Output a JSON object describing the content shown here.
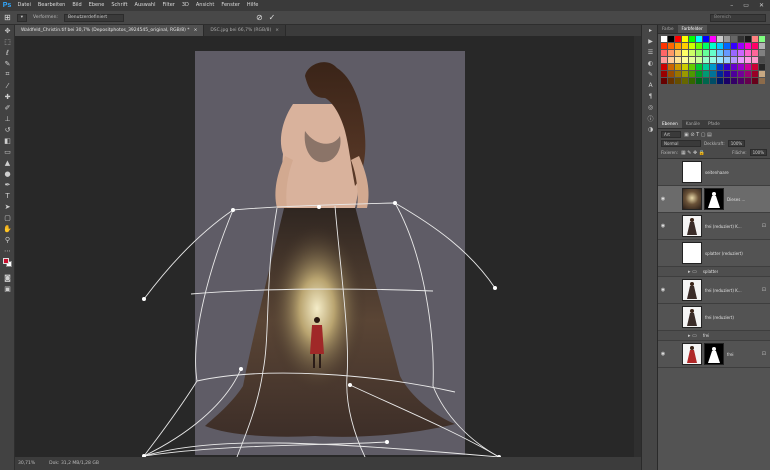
{
  "app": {
    "logo": "Ps"
  },
  "menu": [
    "Datei",
    "Bearbeiten",
    "Bild",
    "Ebene",
    "Schrift",
    "Auswahl",
    "Filter",
    "3D",
    "Ansicht",
    "Fenster",
    "Hilfe"
  ],
  "window_controls": [
    "–",
    "▭",
    "✕"
  ],
  "options": {
    "interpolation_label": "Verformen:",
    "interpolation_value": "Benutzerdefiniert",
    "cancel": "⊘",
    "commit": "✓"
  },
  "search": {
    "placeholder": "Bereich"
  },
  "tabs": [
    {
      "label": "Waldfeld_Christin.tif bei 30,7% (Depositphotos_3924545_original, RGB/8) *",
      "close": "×"
    },
    {
      "label": "DSC.jpg bei 66,7% (RGB/8)",
      "close": "×"
    }
  ],
  "status": {
    "zoom": "30,71%",
    "doc": "Dok: 31,2 MB/1,28 GB"
  },
  "panels": {
    "swatch_tabs": [
      "Farbe",
      "Farbfelder"
    ],
    "layer_tabs": [
      "Ebenen",
      "Kanäle",
      "Pfade"
    ],
    "kind_label": "Art",
    "blend_mode": "Normal",
    "opacity_label": "Deckkraft:",
    "opacity_value": "100%",
    "fill_label": "Fläche:",
    "fill_value": "100%",
    "lock_label": "Fixieren:"
  },
  "swatch_colors": [
    "#ffffff",
    "#000000",
    "#ff0000",
    "#ffff00",
    "#00ff00",
    "#00ffff",
    "#0000ff",
    "#ff00ff",
    "#cccccc",
    "#999999",
    "#666666",
    "#333333",
    "#1a1a1a",
    "#ff8080",
    "#80ff80",
    "#ff3300",
    "#ff6600",
    "#ff9900",
    "#ffcc00",
    "#ccff00",
    "#66ff00",
    "#00ff66",
    "#00ffcc",
    "#00ccff",
    "#0066ff",
    "#3300ff",
    "#9900ff",
    "#ff00cc",
    "#ff0066",
    "#b3b3b3",
    "#ff6666",
    "#ff9966",
    "#ffcc66",
    "#ffff66",
    "#ccff66",
    "#99ff66",
    "#66ff99",
    "#66ffcc",
    "#66ccff",
    "#6699ff",
    "#9966ff",
    "#cc66ff",
    "#ff66cc",
    "#ff6699",
    "#808080",
    "#ff9999",
    "#ffcc99",
    "#ffe699",
    "#ffff99",
    "#e6ff99",
    "#ccff99",
    "#99ffcc",
    "#99ffe6",
    "#99e6ff",
    "#99ccff",
    "#b399ff",
    "#e699ff",
    "#ff99e6",
    "#ff99cc",
    "#4d4d4d",
    "#cc0000",
    "#cc6600",
    "#cc9900",
    "#cccc00",
    "#66cc00",
    "#00cc33",
    "#00cc99",
    "#0099cc",
    "#0033cc",
    "#3300cc",
    "#6600cc",
    "#9900cc",
    "#cc0099",
    "#cc0033",
    "#262626",
    "#990000",
    "#994c00",
    "#997300",
    "#999900",
    "#4d9900",
    "#009926",
    "#009973",
    "#007399",
    "#002699",
    "#260099",
    "#4d0099",
    "#730099",
    "#990073",
    "#990026",
    "#c8a882",
    "#660000",
    "#663300",
    "#664d00",
    "#666600",
    "#336600",
    "#00661a",
    "#00664d",
    "#004d66",
    "#001a66",
    "#1a0066",
    "#330066",
    "#4d0066",
    "#66004d",
    "#66001a",
    "#8c6b4a"
  ],
  "layers": [
    {
      "name": "seitenhaare",
      "kind": "layer",
      "visible": false,
      "selected": false,
      "thumb": "white",
      "mask": false,
      "lock": false
    },
    {
      "name": "Dieses ...",
      "kind": "layer",
      "visible": true,
      "selected": true,
      "thumb": "forest",
      "mask": true,
      "lock": false
    },
    {
      "name": "frei (reduziert) K...",
      "kind": "layer",
      "visible": true,
      "selected": false,
      "thumb": "woman",
      "mask": false,
      "lock": true
    },
    {
      "name": "splatter (reduziert)",
      "kind": "layer",
      "visible": false,
      "selected": false,
      "thumb": "white",
      "mask": false,
      "lock": false
    },
    {
      "name": "splatter",
      "kind": "group",
      "visible": false,
      "selected": false
    },
    {
      "name": "frei (reduziert) K...",
      "kind": "layer",
      "visible": true,
      "selected": false,
      "thumb": "woman",
      "mask": false,
      "lock": true
    },
    {
      "name": "frei (reduziert)",
      "kind": "layer",
      "visible": false,
      "selected": false,
      "thumb": "woman",
      "mask": false,
      "lock": false
    },
    {
      "name": "frei",
      "kind": "group",
      "visible": false,
      "selected": false
    },
    {
      "name": "frei",
      "kind": "layer",
      "visible": true,
      "selected": false,
      "thumb": "red",
      "mask": true,
      "lock": true
    }
  ],
  "tools": [
    "move-icon",
    "marquee-icon",
    "lasso-icon",
    "quick-select-icon",
    "crop-icon",
    "eyedropper-icon",
    "healing-icon",
    "brush-icon",
    "stamp-icon",
    "history-brush-icon",
    "eraser-icon",
    "gradient-icon",
    "blur-icon",
    "dodge-icon",
    "pen-icon",
    "type-icon",
    "path-select-icon",
    "shape-icon",
    "hand-icon",
    "zoom-icon"
  ],
  "colors": {
    "foreground": "#c8102e",
    "background": "#ffffff"
  }
}
